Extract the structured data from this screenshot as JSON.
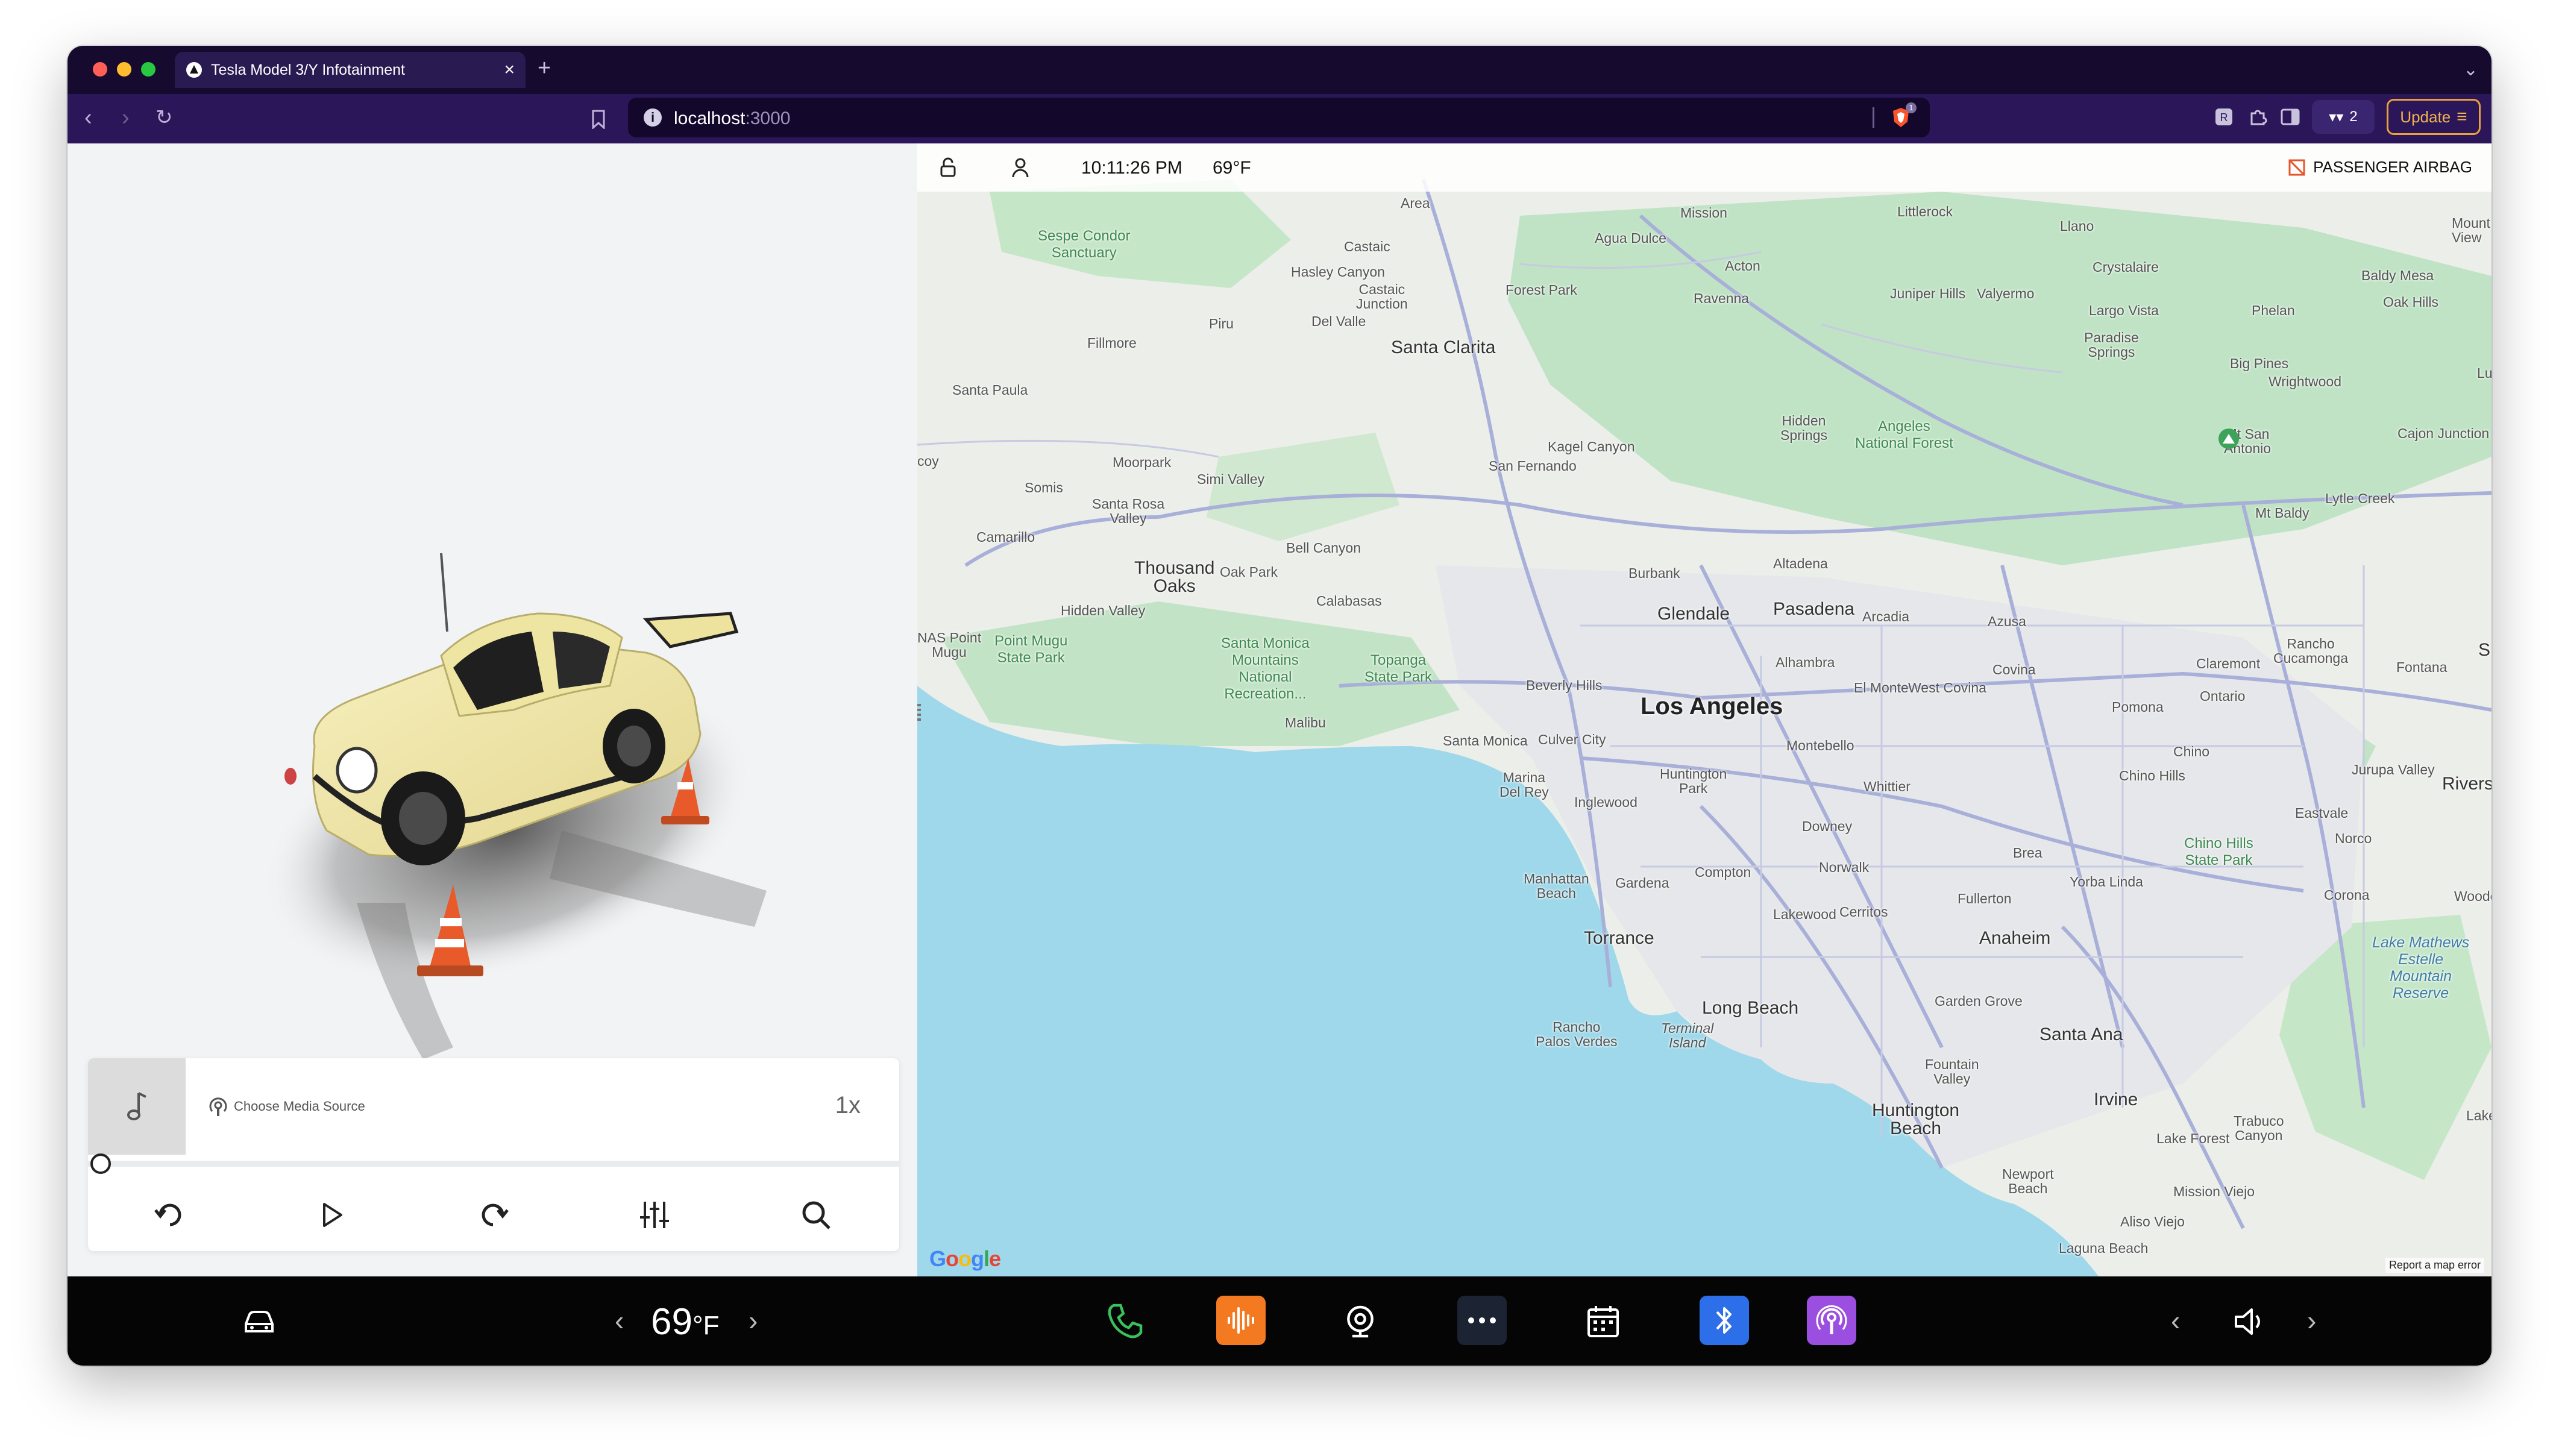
{
  "browser": {
    "tab_title": "Tesla Model 3/Y Infotainment",
    "new_tab": "+",
    "url_host": "localhost",
    "url_port": ":3000",
    "shield_count": "1",
    "wallet_count": "2",
    "update_label": "Update"
  },
  "status": {
    "time": "10:11:26 PM",
    "temperature": "69°F",
    "airbag_label": "PASSENGER AIRBAG"
  },
  "media": {
    "source_label": "Choose Media Source",
    "speed": "1x",
    "progress_fraction": 0
  },
  "climate": {
    "temp_value": "69",
    "temp_unit": "°F"
  },
  "map": {
    "labels": {
      "los_angeles": "Los Angeles",
      "santa_clarita": "Santa Clarita",
      "glendale": "Glendale",
      "pasadena": "Pasadena",
      "burbank": "Burbank",
      "thousand_oaks": "Thousand\nOaks",
      "torrance": "Torrance",
      "long_beach": "Long Beach",
      "anaheim": "Anaheim",
      "santa_ana": "Santa Ana",
      "irvine": "Irvine",
      "huntington_beach": "Huntington\nBeach",
      "santa_monica": "Santa Monica",
      "malibu": "Malibu",
      "riverside": "Riverside",
      "ontario": "Ontario",
      "pomona": "Pomona",
      "covina": "Covina",
      "whittier": "Whittier",
      "downey": "Downey",
      "compton": "Compton",
      "inglewood": "Inglewood",
      "culver_city": "Culver City",
      "beverly_hills": "Beverly Hills",
      "fullerton": "Fullerton",
      "norwalk": "Norwalk",
      "chino": "Chino",
      "chino_hills": "Chino Hills",
      "corona": "Corona",
      "fontana": "Fontana",
      "rancho_cucamonga": "Rancho\nCucamonga",
      "claremont": "Claremont",
      "azusa": "Azusa",
      "arcadia": "Arcadia",
      "alhambra": "Alhambra",
      "el_monte": "El Monte",
      "west_covina": "West Covina",
      "montebello": "Montebello",
      "san_fernando": "San Fernando",
      "kagel_canyon": "Kagel Canyon",
      "simi_valley": "Simi Valley",
      "moorpark": "Moorpark",
      "fillmore": "Fillmore",
      "santa_paula": "Santa Paula",
      "camarillo": "Camarillo",
      "somis": "Somis",
      "piru": "Piru",
      "del_valle": "Del Valle",
      "castaic": "Castaic",
      "castaic_junction": "Castaic\nJunction",
      "hasley_canyon": "Hasley Canyon",
      "agua_dulce": "Agua Dulce",
      "acton": "Acton",
      "ravenna": "Ravenna",
      "forest_park": "Forest Park",
      "mission": "Mission",
      "littlerock": "Littlerock",
      "llano": "Llano",
      "crystalaire": "Crystalaire",
      "juniper_hills": "Juniper Hills",
      "valyermo": "Valyermo",
      "largo_vista": "Largo Vista",
      "phelan": "Phelan",
      "baldy_mesa": "Baldy Mesa",
      "oak_hills": "Oak Hills",
      "paradise_springs": "Paradise\nSprings",
      "big_pines": "Big Pines",
      "wrightwood": "Wrightwood",
      "cajon_junction": "Cajon Junction",
      "mt_san_antonio": "Mt San\nAntonio",
      "mt_baldy": "Mt Baldy",
      "lytle_creek": "Lytle Creek",
      "angeles_nf": "Angeles\nNational Forest",
      "hidden_springs": "Hidden\nSprings",
      "altadena": "Altadena",
      "bell_canyon": "Bell Canyon",
      "calabasas": "Calabasas",
      "oak_park": "Oak Park",
      "hidden_valley": "Hidden Valley",
      "santa_rosa_valley": "Santa Rosa\nValley",
      "nas_point_mugu": "NAS Point\nMugu",
      "point_mugu_sp": "Point Mugu\nState Park",
      "santa_monica_mtns": "Santa Monica\nMountains\nNational\nRecreation...",
      "topanga_sp": "Topanga\nState Park",
      "sespe": "Sespe Condor\nSanctuary",
      "marina_del_rey": "Marina\nDel Rey",
      "manhattan_beach": "Manhattan\nBeach",
      "gardena": "Gardena",
      "huntington_park": "Huntington\nPark",
      "lakewood": "Lakewood",
      "cerritos": "Cerritos",
      "rancho_palos_verdes": "Rancho\nPalos Verdes",
      "terminal_island": "Terminal\nIsland",
      "garden_grove": "Garden Grove",
      "fountain_valley": "Fountain\nValley",
      "brea": "Brea",
      "yorba_linda": "Yorba Linda",
      "chino_hills_sp": "Chino Hills\nState Park",
      "eastvale": "Eastvale",
      "norco": "Norco",
      "jurupa_valley": "Jurupa Valley",
      "lake_mathews": "Lake Mathews\nEstelle\nMountain\nReserve",
      "newport_beach": "Newport\nBeach",
      "lake_forest": "Lake Forest",
      "mission_viejo": "Mission Viejo",
      "aliso_viejo": "Aliso Viejo",
      "laguna_beach": "Laguna Beach",
      "trabuco_canyon": "Trabuco\nCanyon",
      "area": "Area",
      "woodc": "Woodc",
      "lake": "Lake",
      "mount_view": "Mount\nView",
      "lu": "Lu",
      "s": "S",
      "coy": "coy",
      "google": "Google",
      "report": "Report a map error"
    }
  },
  "colors": {
    "tabbar": "#160a2e",
    "navbar": "#2b1659",
    "update_border": "#e9a23b",
    "phone_icon": "#39c15a",
    "audio_app": "#f47a22",
    "bluetooth_app": "#2c6fe8",
    "podcast_app": "#9b4fe0",
    "dots_app": "#1c2333",
    "map_water": "#9ed8ea",
    "map_green": "#bfe3c4",
    "car_body": "#f1e7a8"
  },
  "icons": {
    "lock": "lock-icon",
    "profile": "person-icon",
    "airbag": "airbag-off-icon",
    "car": "car-icon",
    "phone": "phone-icon",
    "audio": "waveform-icon",
    "camera": "camera-icon",
    "more": "more-icon",
    "calendar": "calendar-icon",
    "bluetooth": "bluetooth-icon",
    "podcast": "podcast-icon",
    "volume": "volume-icon"
  }
}
